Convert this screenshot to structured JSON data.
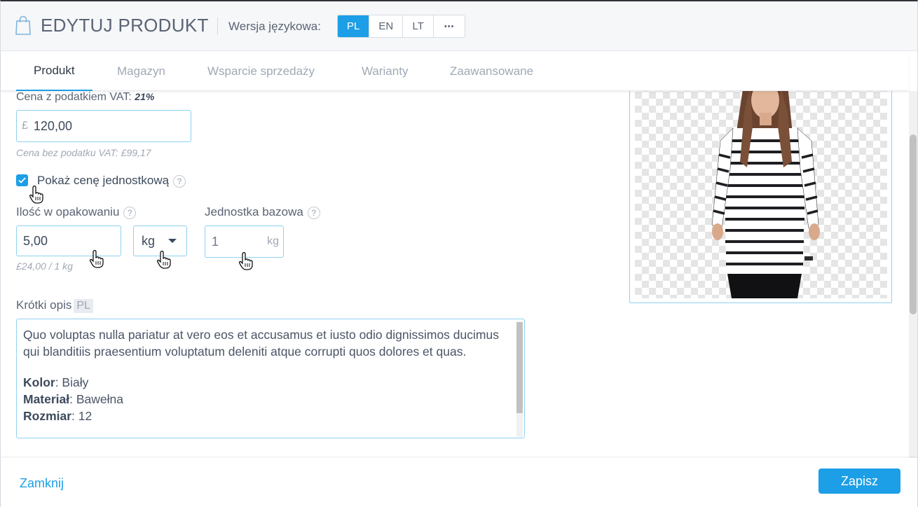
{
  "header": {
    "title": "EDYTUJ PRODUKT",
    "icon": "shopping-bag-icon",
    "language_label": "Wersja językowa:",
    "languages": [
      {
        "label": "PL",
        "active": true
      },
      {
        "label": "EN",
        "active": false
      },
      {
        "label": "LT",
        "active": false
      },
      {
        "label": "•••",
        "active": false
      }
    ]
  },
  "tabs": [
    {
      "label": "Produkt",
      "active": true
    },
    {
      "label": "Magazyn",
      "active": false
    },
    {
      "label": "Wsparcie sprzedaży",
      "active": false
    },
    {
      "label": "Warianty",
      "active": false
    },
    {
      "label": "Zaawansowane",
      "active": false
    }
  ],
  "pricing": {
    "vat_label": "Cena z podatkiem VAT:",
    "vat_rate": "21%",
    "currency_symbol": "£",
    "price_value": "120,00",
    "net_price_hint": "Cena bez podatku VAT: £99,17"
  },
  "unit_price": {
    "checkbox_label": "Pokaż cenę jednostkową",
    "checked": true,
    "quantity_label": "Ilość w opakowaniu",
    "quantity_value": "5,00",
    "unit_value": "kg",
    "per_unit_hint": "£24,00 / 1 kg",
    "base_unit_label": "Jednostka bazowa",
    "base_unit_value": "1",
    "base_unit_suffix": "kg"
  },
  "short_description": {
    "label": "Krótki opis",
    "lang_tag": "PL",
    "paragraph": "Quo voluptas nulla pariatur at vero eos et accusamus et iusto odio dignissimos ducimus qui blanditiis praesentium voluptatum deleniti atque corrupti quos dolores et quas.",
    "attributes": [
      {
        "key": "Kolor",
        "value": ": Biały"
      },
      {
        "key": "Materiał",
        "value": ": Bawełna"
      },
      {
        "key": "Rozmiar",
        "value": ": 12"
      }
    ]
  },
  "footer": {
    "close_label": "Zamknij",
    "save_label": "Zapisz"
  },
  "colors": {
    "accent": "#1c9fe6",
    "input_border": "#8fd1f2",
    "text": "#3d4a5c",
    "muted": "#a0a8b4"
  }
}
